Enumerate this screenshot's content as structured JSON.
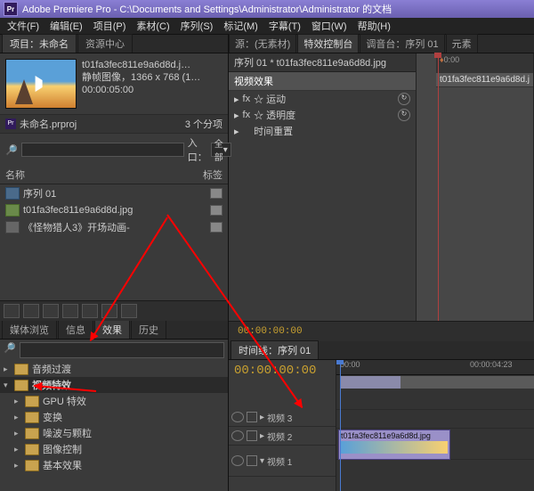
{
  "title": "Adobe Premiere Pro - C:\\Documents and Settings\\Administrator\\Administrator 的文档",
  "menu": [
    "文件(F)",
    "编辑(E)",
    "项目(P)",
    "素材(C)",
    "序列(S)",
    "标记(M)",
    "字幕(T)",
    "窗口(W)",
    "帮助(H)"
  ],
  "project_panel": {
    "tabs": [
      "项目：未命名",
      "资源中心"
    ],
    "clip_name": "t01fa3fec811e9a6d8d.j…",
    "clip_meta1": "静帧图像，1366 x 768 (1…",
    "clip_meta2": "00:00:05:00",
    "proj_file": "未命名.prproj",
    "items_count": "3 个分项",
    "in_label": "入口：",
    "in_value": "全部",
    "col_name": "名称",
    "col_label": "标签",
    "rows": [
      {
        "type": "seq",
        "name": "序列 01"
      },
      {
        "type": "img",
        "name": "t01fa3fec811e9a6d8d.jpg"
      },
      {
        "type": "aud",
        "name": "《怪物猎人3》开场动画-"
      }
    ]
  },
  "browser_panel": {
    "tabs": [
      "媒体浏览",
      "信息",
      "效果",
      "历史"
    ],
    "folders": [
      "音频过渡",
      "视频特效",
      "GPU 特效",
      "变换",
      "噪波与颗粒",
      "图像控制",
      "基本效果"
    ]
  },
  "source_panel": {
    "tabs": [
      "源：(无素材)",
      "特效控制台",
      "调音台：序列 01",
      "元素"
    ],
    "heading": "序列 01 * t01fa3fec811e9a6d8d.jpg",
    "section": "视频效果",
    "rows": [
      "☆ 运动",
      "☆ 透明度",
      "时间重置"
    ],
    "ruler_start": "0:00",
    "clip_label": "t01fa3fec811e9a6d8d.j"
  },
  "timeline": {
    "tab": "时间线：序列 01",
    "tc": "00:00:00:00",
    "ruler": [
      "00:00",
      "00:00:04:23"
    ],
    "tc_small": "00:00:00:00",
    "tracks": [
      "视频 3",
      "视频 2",
      "视频 1"
    ],
    "clip": "t01fa3fec811e9a6d8d.jpg"
  }
}
